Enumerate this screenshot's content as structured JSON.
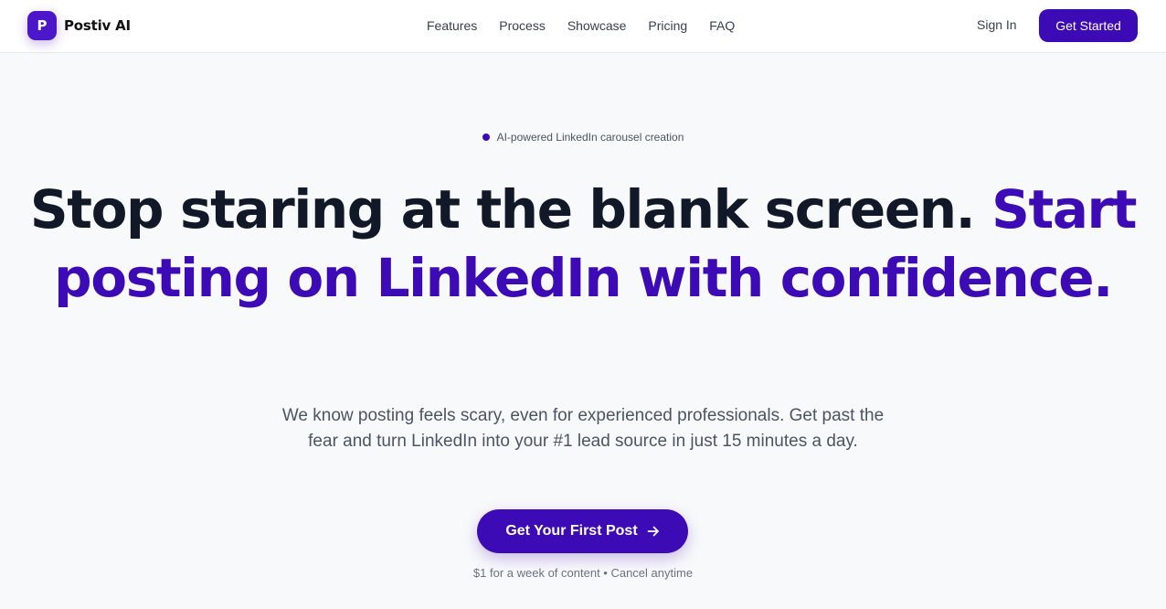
{
  "header": {
    "brand_initial": "P",
    "brand_name": "Postiv AI",
    "nav": [
      {
        "label": "Features"
      },
      {
        "label": "Process"
      },
      {
        "label": "Showcase"
      },
      {
        "label": "Pricing"
      },
      {
        "label": "FAQ"
      }
    ],
    "sign_in_label": "Sign In",
    "cta_label": "Get Started"
  },
  "hero": {
    "badge": "AI-powered LinkedIn carousel creation",
    "headline_part1": "Stop staring at the blank screen. ",
    "headline_accent": "Start posting on LinkedIn with confidence.",
    "subtitle": "We know posting feels scary, even for experienced professionals. Get past the fear and turn LinkedIn into your #1 lead source in just 15 minutes a day.",
    "cta_label": "Get Your First Post",
    "cta_icon": "arrow-right-icon",
    "footnote": "$1 for a week of content • Cancel anytime"
  },
  "colors": {
    "accent": "#3d0bb5",
    "logo": "#4b17c8",
    "heading": "#111827",
    "body_text": "#4b5563",
    "background": "#f8f9fb"
  }
}
